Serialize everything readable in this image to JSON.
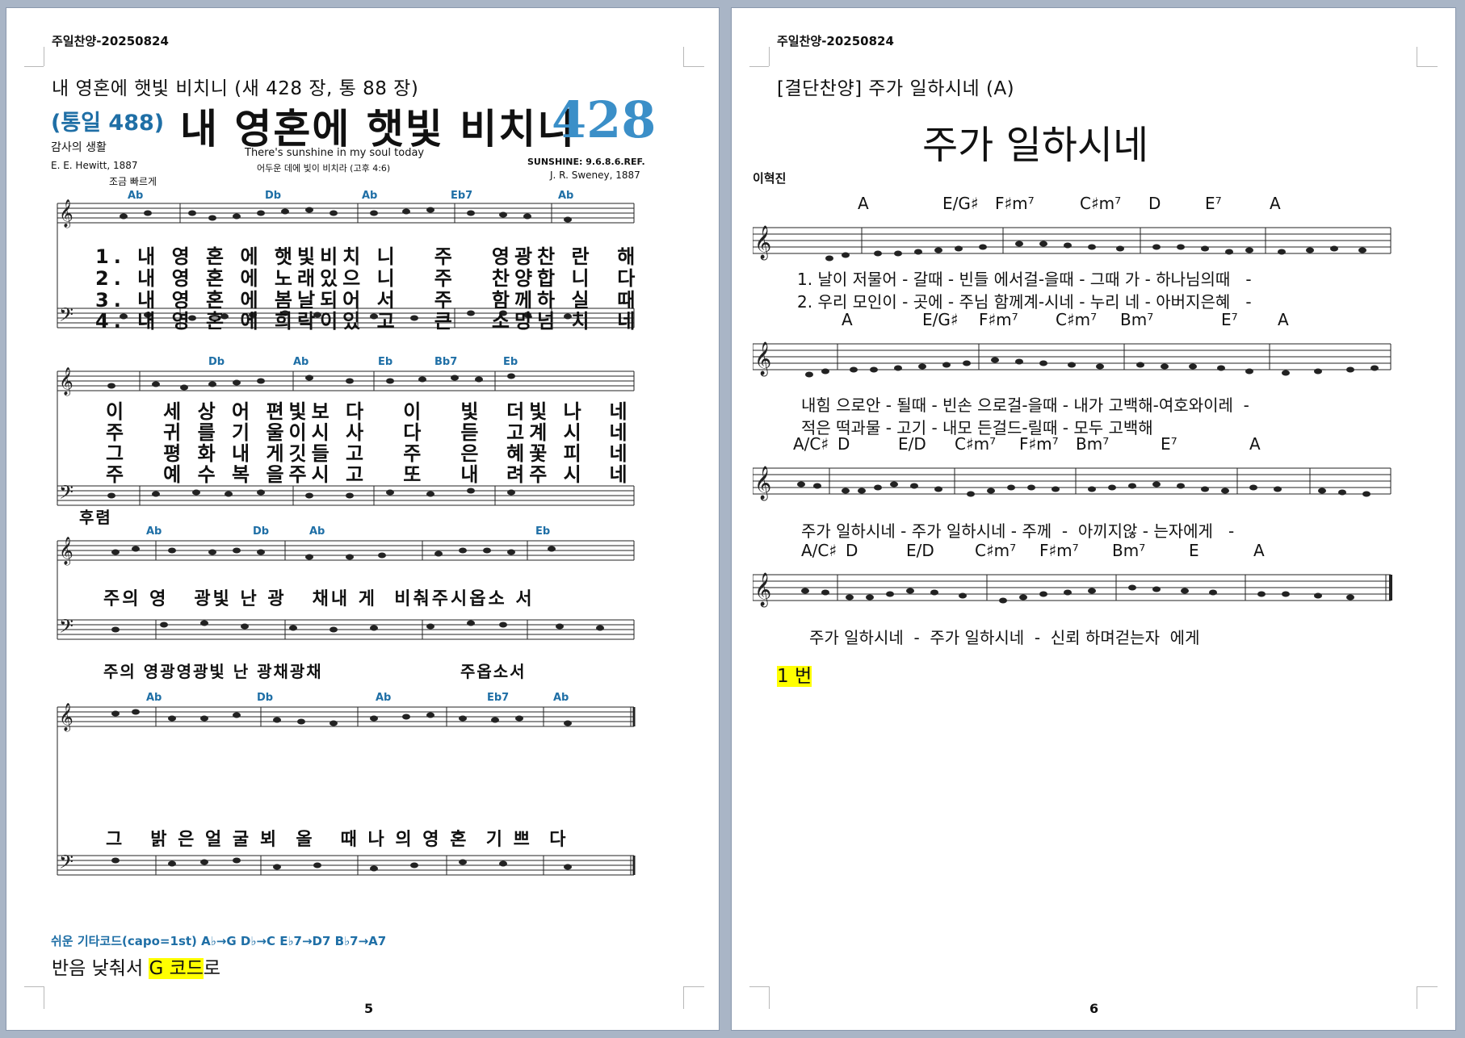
{
  "left_page": {
    "header": "주일찬양-20250824",
    "subtitle": "내 영혼에 햇빛 비치니 (새 428 장, 통 88 장)",
    "hymn": {
      "tong": "(통일 488)",
      "title": "내 영혼에 햇빛 비치니",
      "number": "428",
      "category": "감사의 생활",
      "english": "There's sunshine in my soul today",
      "scripture": "어두운 데에 빛이 비치라 (고후 4:6)",
      "meter": "SUNSHINE: 9.6.8.6.REF.",
      "author": "E. E. Hewitt, 1887",
      "composer": "J. R. Sweney, 1887",
      "tempo": "조금 빠르게",
      "verse_lines_1": [
        "1. 내 영 혼 에 햇빛비치 니   주   영광찬 란  해",
        "2. 내 영 혼 에 노래있으 니   주   찬양합 니  다",
        "3. 내 영 혼 에 봄날되어 서   주   함께하 실  때",
        "4. 내 영 혼 에 희락이있 고   큰   소망넘 치  네"
      ],
      "verse_lines_2": [
        "이   세 상 어 편빛보 다   이   빛  더빛 나  네",
        "주   귀 를 기 울이시 사   다   듣  고계 시  네",
        "그   평 화 내 게깃들 고   주   은  혜꽃 피  네",
        "주   예 수 복 을주시 고   또   내  려주 시  네"
      ],
      "refrain_label": "후렴",
      "refrain_1": "주의 영   광빛 난 광   채내 게  비춰주시옵소 서",
      "refrain_2": "주의 영광영광빛 난 광채광채                   주옵소서",
      "refrain_3": "그   밝 은 얼 굴 뵈  올   때 나 의 영 혼  기 쁘  다",
      "chords_row1": [
        "Ab",
        "Db",
        "Ab",
        "Eb7",
        "Ab"
      ],
      "chords_row2": [
        "Db",
        "Ab",
        "Eb",
        "Bb7",
        "Eb"
      ],
      "chords_row3": [
        "Ab",
        "Db",
        "Ab",
        "Eb"
      ],
      "chords_row4": [
        "Ab",
        "Db",
        "Ab",
        "Eb7",
        "Ab"
      ],
      "capo": "쉬운 기타코드(capo=1st) A♭→G   D♭→C   E♭7→D7   B♭7→A7"
    },
    "footnote_pre": "반음 낮춰서 ",
    "footnote_hl": "G 코드",
    "footnote_post": "로",
    "page_number": "5"
  },
  "right_page": {
    "header": "주일찬양-20250824",
    "subtitle": "[결단찬양] 주가 일하시네 (A)",
    "score": {
      "title": "주가 일하시네",
      "composer": "이혁진",
      "row1_chords": [
        "A",
        "E/G♯",
        "F♯m⁷",
        "C♯m⁷",
        "D",
        "E⁷",
        "A"
      ],
      "row1_lyric1": "1. 날이 저물어 - 갈때 - 빈들 에서걸-을때 - 그때 가 - 하나님의때   -",
      "row1_lyric2": "2. 우리 모인이 - 곳에 - 주님 함께계-시네 - 누리 네 - 아버지은혜   -",
      "row2_chords": [
        "A",
        "E/G♯",
        "F♯m⁷",
        "C♯m⁷",
        "Bm⁷",
        "E⁷",
        "A"
      ],
      "row2_lyric1": "내힘 으로안 - 될때 - 빈손 으로걸-을때 - 내가 고백해-여호와이레  -",
      "row2_lyric2": "적은 떡과물 - 고기 - 내모 든걸드-릴때 - 모두 고백해",
      "row3_chords": [
        "A/C♯",
        "D",
        "E/D",
        "C♯m⁷",
        "F♯m⁷",
        "Bm⁷",
        "E⁷",
        "A"
      ],
      "row3_lyric": "주가 일하시네 - 주가 일하시네 - 주께  -  아끼지않 - 는자에게   -",
      "row4_chords": [
        "A/C♯",
        "D",
        "E/D",
        "C♯m⁷",
        "F♯m⁷",
        "Bm⁷",
        "E",
        "A"
      ],
      "row4_lyric": "주가 일하시네  -  주가 일하시네  -  신뢰 하며걷는자  에게"
    },
    "note": "1 번",
    "page_number": "6"
  }
}
